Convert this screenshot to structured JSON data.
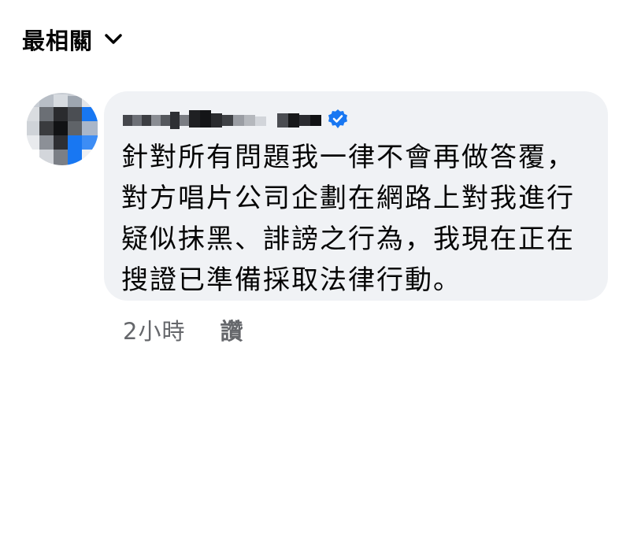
{
  "sort": {
    "label": "最相關",
    "icon": "chevron-down-icon"
  },
  "comment": {
    "avatar_icon": "pixelated-avatar",
    "author": "",
    "verified_icon": "verified-badge-icon",
    "verified_color": "#1877f2",
    "text": "針對所有問題我一律不會再做答覆，\n對方唱片公司企劃在網路上對我進行\n疑似抹黑、誹謗之行為，我現在正在\n搜證已準備採取法律行動。",
    "timestamp": "2小時",
    "like_label": "讚"
  },
  "colors": {
    "bubble_bg": "#f0f2f5",
    "meta_text": "#65676b",
    "primary_text": "#050505"
  }
}
